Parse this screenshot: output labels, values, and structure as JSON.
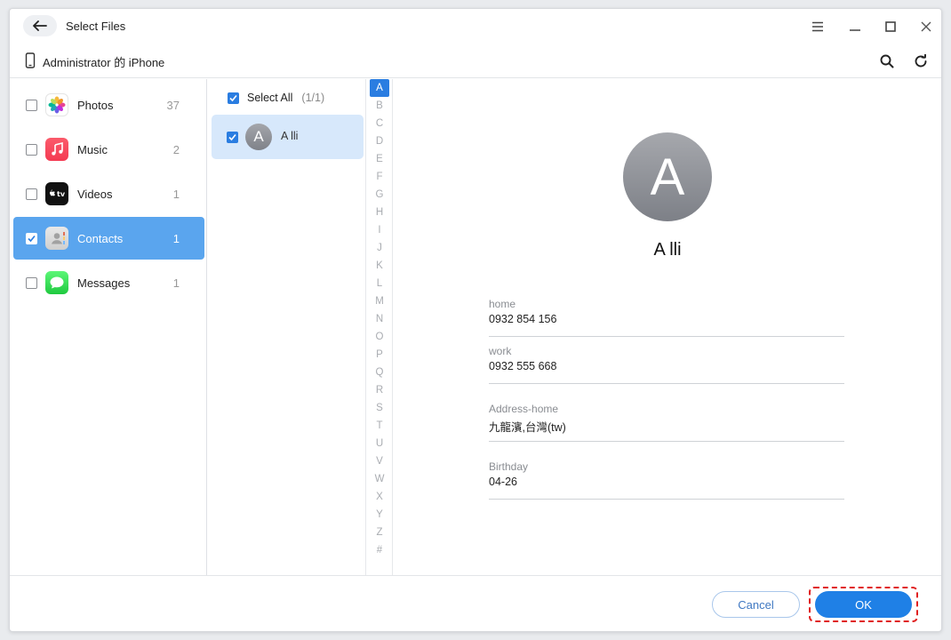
{
  "window": {
    "title": "Select Files"
  },
  "device": {
    "name": "Administrator 的 iPhone"
  },
  "categories": [
    {
      "label": "Photos",
      "count": "37",
      "icon": "photos-icon"
    },
    {
      "label": "Music",
      "count": "2",
      "icon": "music-icon"
    },
    {
      "label": "Videos",
      "count": "1",
      "icon": "appletv-icon"
    },
    {
      "label": "Contacts",
      "count": "1",
      "icon": "contacts-icon"
    },
    {
      "label": "Messages",
      "count": "1",
      "icon": "messages-icon"
    }
  ],
  "selected_category": "Contacts",
  "list": {
    "select_all_label": "Select All",
    "select_all_count": "(1/1)",
    "contacts": [
      {
        "initial": "A",
        "name": "A lli"
      }
    ]
  },
  "alphabet": [
    "A",
    "B",
    "C",
    "D",
    "E",
    "F",
    "G",
    "H",
    "I",
    "J",
    "K",
    "L",
    "M",
    "N",
    "O",
    "P",
    "Q",
    "R",
    "S",
    "T",
    "U",
    "V",
    "W",
    "X",
    "Y",
    "Z",
    "#"
  ],
  "active_letter": "A",
  "detail": {
    "initial": "A",
    "name": "A lli",
    "fields": [
      {
        "label": "home",
        "value": "0932 854 156"
      },
      {
        "label": "work",
        "value": "0932 555 668"
      },
      {
        "label": "Address-home",
        "value": "九龍濱,台灣(tw)"
      },
      {
        "label": "Birthday",
        "value": "04-26"
      }
    ]
  },
  "footer": {
    "cancel_label": "Cancel",
    "ok_label": "OK"
  },
  "colors": {
    "accent": "#2a7de1",
    "selected_row": "#d7e8fb",
    "sidebar_active": "#5aa5ee",
    "highlight_border": "#e02020"
  }
}
